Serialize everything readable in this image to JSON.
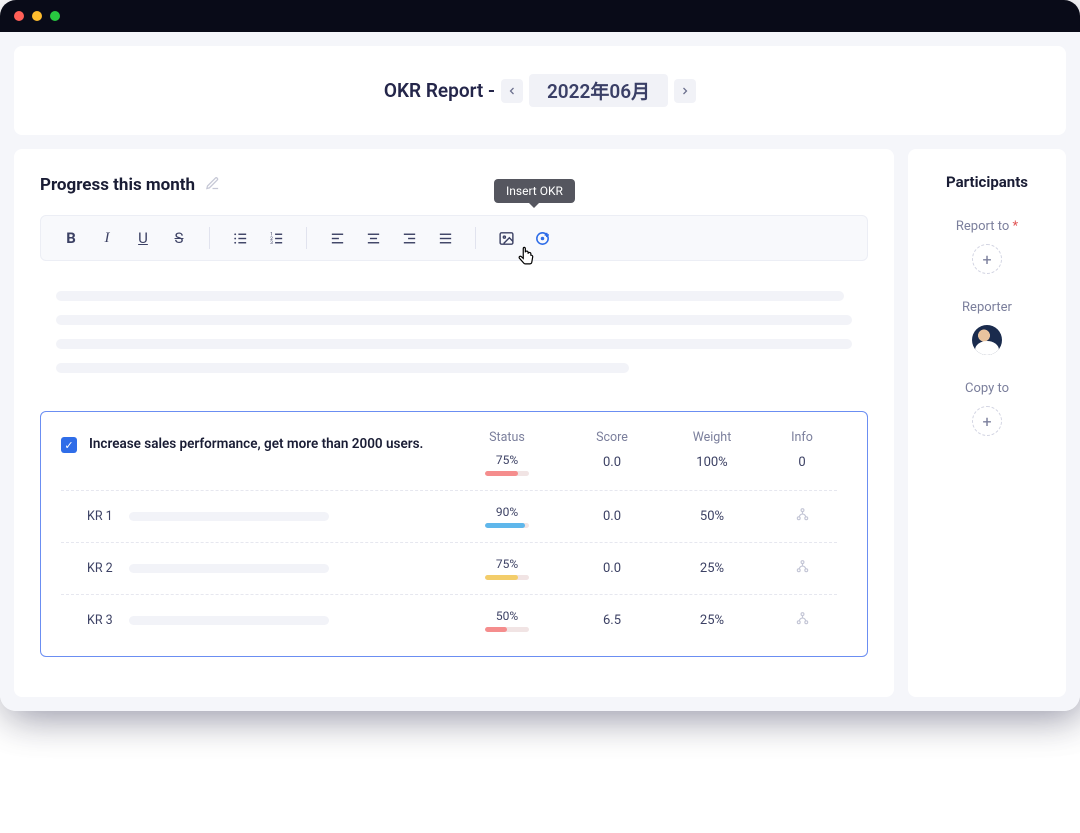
{
  "header": {
    "title_prefix": "OKR Report - ",
    "month": "2022年06月"
  },
  "editor": {
    "section_title": "Progress this month",
    "toolbar": {
      "tooltip_insert_okr": "Insert OKR"
    },
    "okr": {
      "objective": "Increase sales performance, get more than 2000 users.",
      "columns": {
        "status": "Status",
        "score": "Score",
        "weight": "Weight",
        "info": "Info"
      },
      "objective_row": {
        "status_pct": "75%",
        "status_fill": 75,
        "status_color": "red",
        "score": "0.0",
        "weight": "100%",
        "info": "0"
      },
      "krs": [
        {
          "label": "KR 1",
          "status_pct": "90%",
          "status_fill": 90,
          "status_color": "blue",
          "score": "0.0",
          "weight": "50%"
        },
        {
          "label": "KR 2",
          "status_pct": "75%",
          "status_fill": 75,
          "status_color": "yellow",
          "score": "0.0",
          "weight": "25%"
        },
        {
          "label": "KR 3",
          "status_pct": "50%",
          "status_fill": 50,
          "status_color": "red",
          "score": "6.5",
          "weight": "25%"
        }
      ]
    }
  },
  "sidebar": {
    "title": "Participants",
    "report_to": "Report to",
    "reporter": "Reporter",
    "copy_to": "Copy to"
  }
}
